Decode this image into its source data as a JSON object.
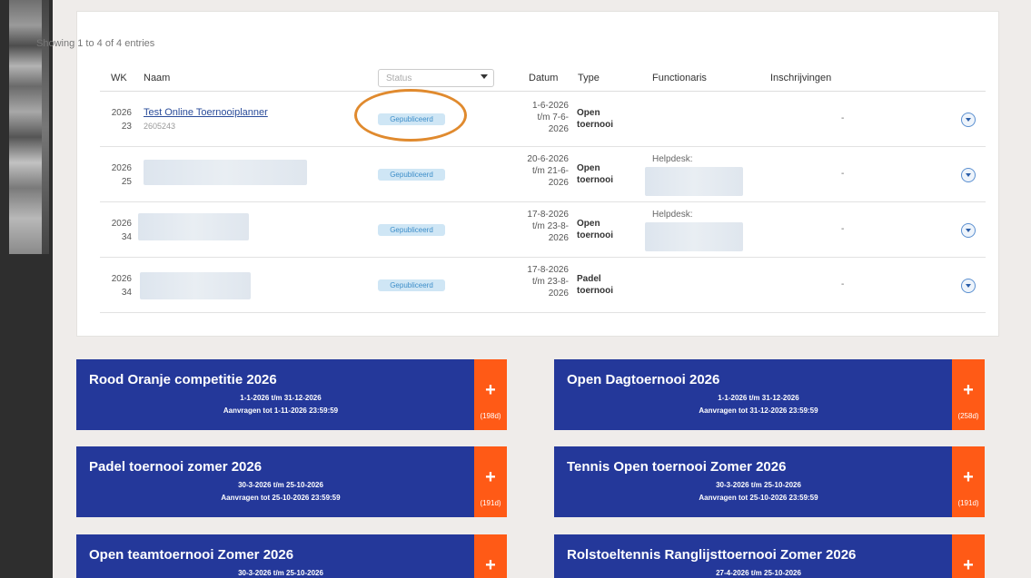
{
  "table": {
    "info": "Showing 1 to 4 of 4 entries",
    "headers": {
      "wk": "WK",
      "naam": "Naam",
      "status_placeholder": "Status",
      "datum": "Datum",
      "type": "Type",
      "functionaris": "Functionaris",
      "inschrijvingen": "Inschrijvingen"
    },
    "rows": [
      {
        "wk_year": "2026",
        "wk_week": "23",
        "naam": "Test Online Toernooiplanner",
        "code": "2605243",
        "status": "Gepubliceerd",
        "datum": [
          "1-6-2026",
          "t/m 7-6-",
          "2026"
        ],
        "type": [
          "Open",
          "toernooi"
        ],
        "functionaris": "",
        "inschrijvingen": "-"
      },
      {
        "wk_year": "2026",
        "wk_week": "25",
        "naam": "",
        "code": "",
        "status": "Gepubliceerd",
        "datum": [
          "20-6-2026",
          "t/m 21-6-",
          "2026"
        ],
        "type": [
          "Open",
          "toernooi"
        ],
        "functionaris": "Helpdesk:",
        "inschrijvingen": "-"
      },
      {
        "wk_year": "2026",
        "wk_week": "34",
        "naam": "",
        "code": "",
        "status": "Gepubliceerd",
        "datum": [
          "17-8-2026",
          "t/m 23-8-",
          "2026"
        ],
        "type": [
          "Open",
          "toernooi"
        ],
        "functionaris": "Helpdesk:",
        "inschrijvingen": "-"
      },
      {
        "wk_year": "2026",
        "wk_week": "34",
        "naam": "",
        "code": "",
        "status": "Gepubliceerd",
        "datum": [
          "17-8-2026",
          "t/m 23-8-",
          "2026"
        ],
        "type": [
          "Padel",
          "toernooi"
        ],
        "functionaris": "",
        "inschrijvingen": "-"
      }
    ]
  },
  "competitions": [
    {
      "title": "Rood Oranje competitie 2026",
      "period": "1-1-2026 t/m 31-12-2026",
      "deadline": "Aanvragen tot 1-11-2026 23:59:59",
      "plus": "+",
      "days": "(198d)"
    },
    {
      "title": "Open Dagtoernooi 2026",
      "period": "1-1-2026 t/m 31-12-2026",
      "deadline": "Aanvragen tot 31-12-2026 23:59:59",
      "plus": "+",
      "days": "(258d)"
    },
    {
      "title": "Padel toernooi zomer 2026",
      "period": "30-3-2026 t/m 25-10-2026",
      "deadline": "Aanvragen tot 25-10-2026 23:59:59",
      "plus": "+",
      "days": "(191d)"
    },
    {
      "title": "Tennis Open toernooi Zomer 2026",
      "period": "30-3-2026 t/m 25-10-2026",
      "deadline": "Aanvragen tot 25-10-2026 23:59:59",
      "plus": "+",
      "days": "(191d)"
    },
    {
      "title": "Open teamtoernooi Zomer 2026",
      "period": "30-3-2026 t/m 25-10-2026",
      "deadline": "",
      "plus": "+",
      "days": ""
    },
    {
      "title": "Rolstoeltennis Ranglijsttoernooi Zomer 2026",
      "period": "27-4-2026 t/m 25-10-2026",
      "deadline": "",
      "plus": "+",
      "days": ""
    }
  ],
  "colors": {
    "card_blue": "#24389a",
    "plus_orange": "#ff5a16",
    "highlight": "#e08a2e",
    "badge_bg": "#cfe6f5"
  }
}
